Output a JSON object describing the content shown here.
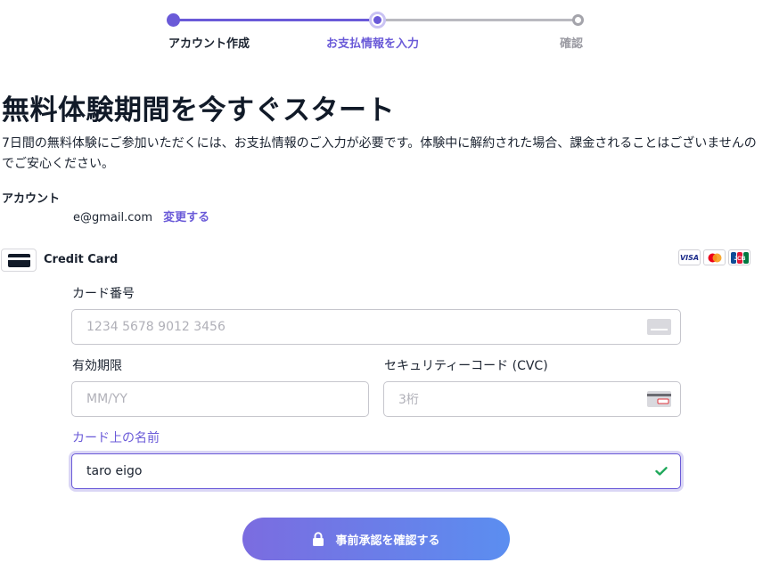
{
  "stepper": {
    "steps": [
      {
        "label": "アカウント作成",
        "state": "done"
      },
      {
        "label": "お支払情報を入力",
        "state": "current"
      },
      {
        "label": "確認",
        "state": "todo"
      }
    ]
  },
  "heading": "無料体験期間を今すぐスタート",
  "description": "7日間の無料体験にご参加いただくには、お支払情報のご入力が必要です。体験中に解約された場合、課金されることはございませんのでご安心ください。",
  "account": {
    "label": "アカウント",
    "email": "e@gmail.com",
    "change_link": "変更する"
  },
  "payment_method": {
    "label": "Credit Card",
    "brands": [
      "VISA",
      "mastercard",
      "JCB"
    ]
  },
  "form": {
    "card_number": {
      "label": "カード番号",
      "placeholder": "1234 5678 9012 3456",
      "value": ""
    },
    "expiry": {
      "label": "有効期限",
      "placeholder": "MM/YY",
      "value": ""
    },
    "cvc": {
      "label": "セキュリティーコード (CVC)",
      "placeholder": "3桁",
      "value": ""
    },
    "name": {
      "label": "カード上の名前",
      "value": "taro eigo"
    }
  },
  "submit_label": "事前承認を確認する",
  "colors": {
    "accent": "#6a5ad8",
    "success": "#1fa85a",
    "button_gradient_start": "#7b6ce0",
    "button_gradient_end": "#5b8ef0"
  }
}
